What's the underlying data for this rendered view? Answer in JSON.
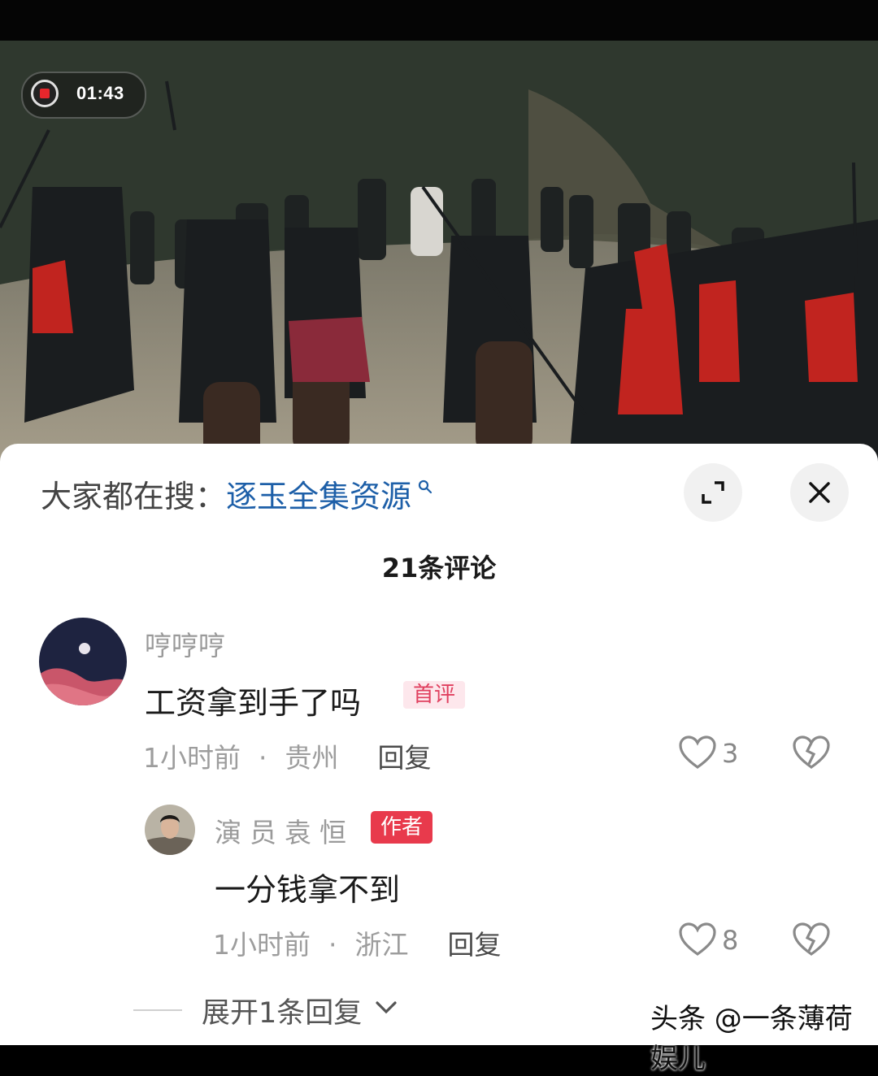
{
  "video": {
    "recording_time": "01:43"
  },
  "search": {
    "prefix": "大家都在搜：",
    "term": "逐玉全集资源"
  },
  "comments_header": {
    "count_label": "21条评论"
  },
  "comments": [
    {
      "username": "哼哼哼",
      "text": "工资拿到手了吗",
      "badge": "首评",
      "time": "1小时前",
      "location": "贵州",
      "reply_label": "回复",
      "likes": "3"
    }
  ],
  "replies": [
    {
      "username": "演员袁恒",
      "badge": "作者",
      "text": "一分钱拿不到",
      "time": "1小时前",
      "location": "浙江",
      "reply_label": "回复",
      "likes": "8"
    }
  ],
  "expand_replies_label": "展开1条回复",
  "watermark": "头条 @一条薄荷娱儿",
  "colors": {
    "search_term": "#1d5fa8",
    "author_badge": "#e83a4c",
    "first_badge_text": "#e0405f"
  }
}
